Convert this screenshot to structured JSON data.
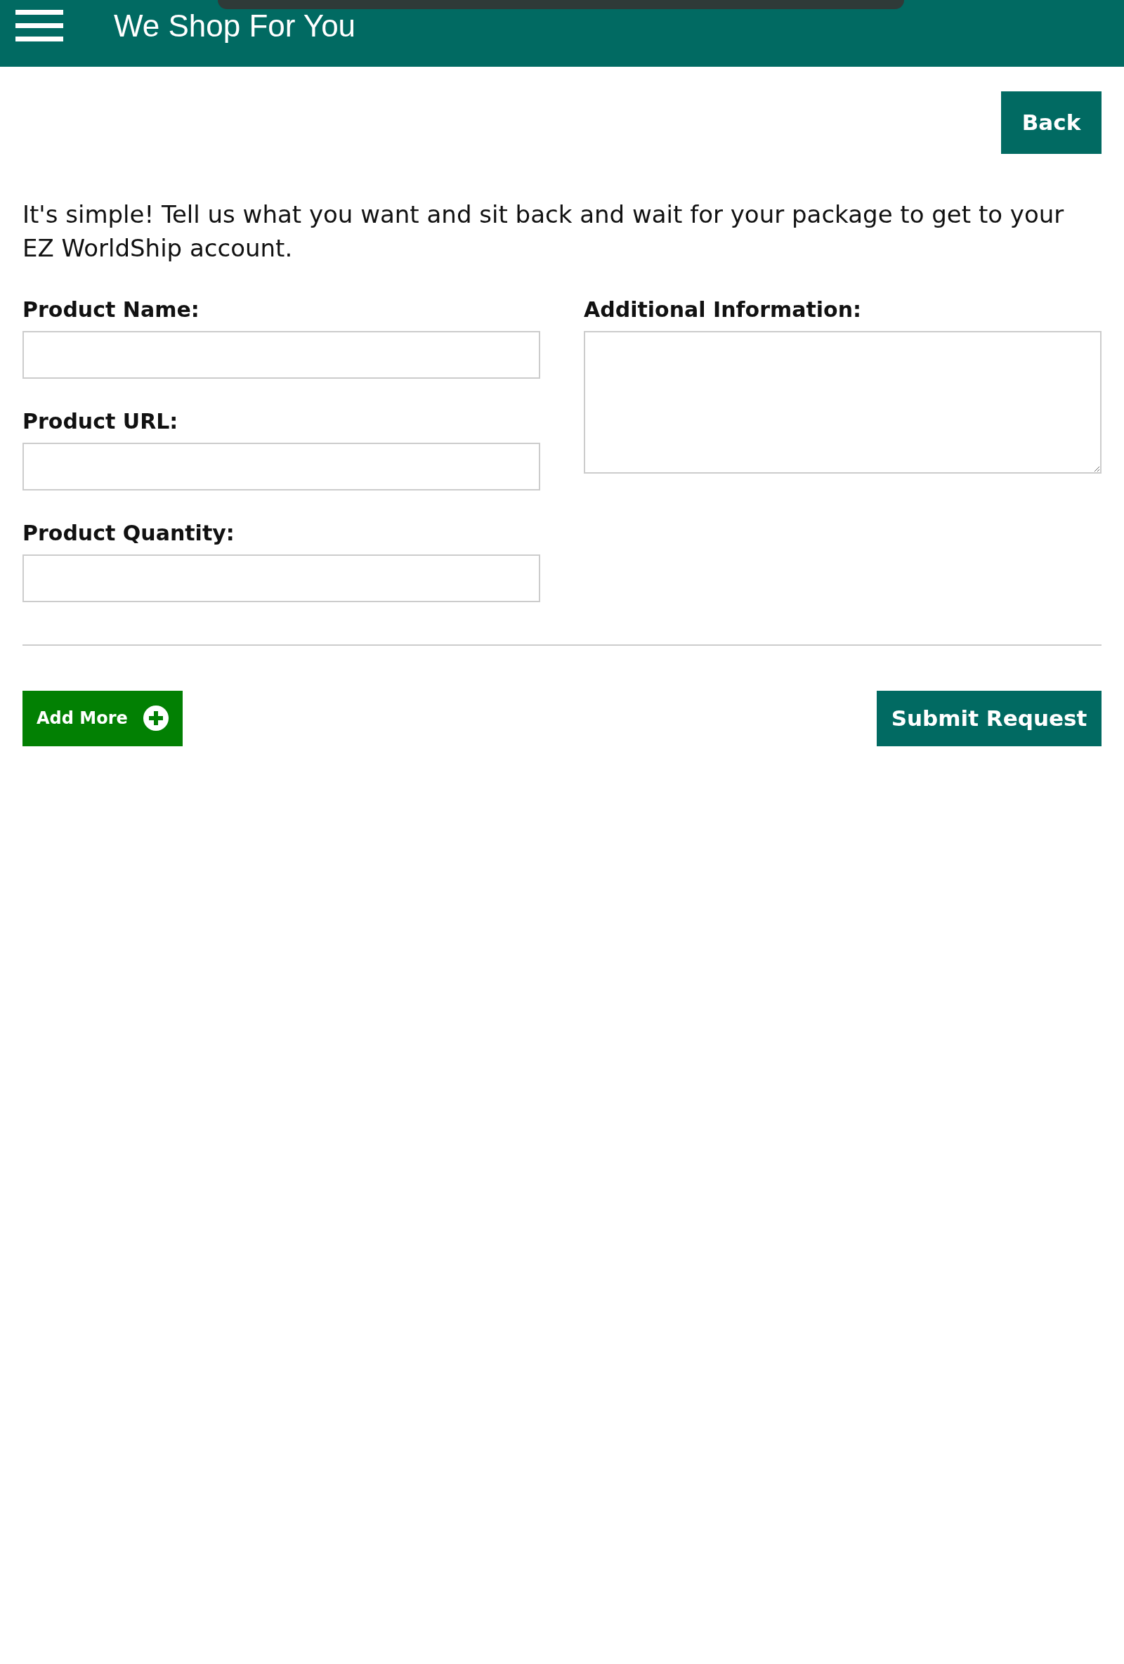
{
  "header": {
    "title": "We Shop For You"
  },
  "back_button": "Back",
  "intro": "It's simple! Tell us what you want and sit back and wait for your package to get to your EZ WorldShip account.",
  "fields_left": [
    {
      "label": "Product Name:",
      "kind": "input"
    },
    {
      "label": "Product URL:",
      "kind": "input"
    },
    {
      "label": "Product Quantity:",
      "kind": "input"
    }
  ],
  "fields_right": [
    {
      "label": "Additional Information:",
      "kind": "textarea"
    }
  ],
  "add_more_button": "Add More",
  "submit_button": "Submit Request"
}
